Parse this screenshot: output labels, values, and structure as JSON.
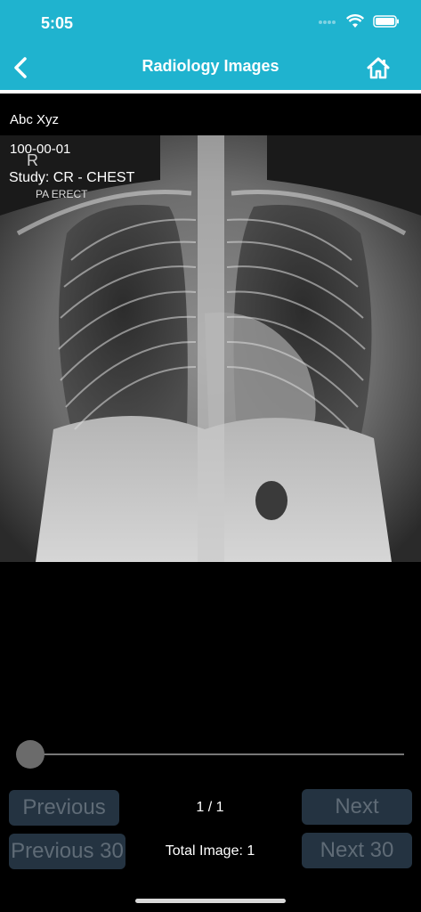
{
  "status": {
    "time": "5:05"
  },
  "header": {
    "title": "Radiology Images"
  },
  "overlay": {
    "patient_name": "Abc Xyz",
    "patient_id": "100-00-01",
    "study": "Study: CR - CHEST",
    "view": "PA ERECT",
    "marker": "R"
  },
  "footer": {
    "counter": "1 / 1",
    "total": "Total Image: 1",
    "previous_label": "Previous",
    "next_label": "Next",
    "previous30_label": "Previous 30",
    "next30_label": "Next 30"
  },
  "colors": {
    "header_bg": "#1fb3cf",
    "button_bg": "#243341",
    "button_text": "#5f6b76"
  }
}
